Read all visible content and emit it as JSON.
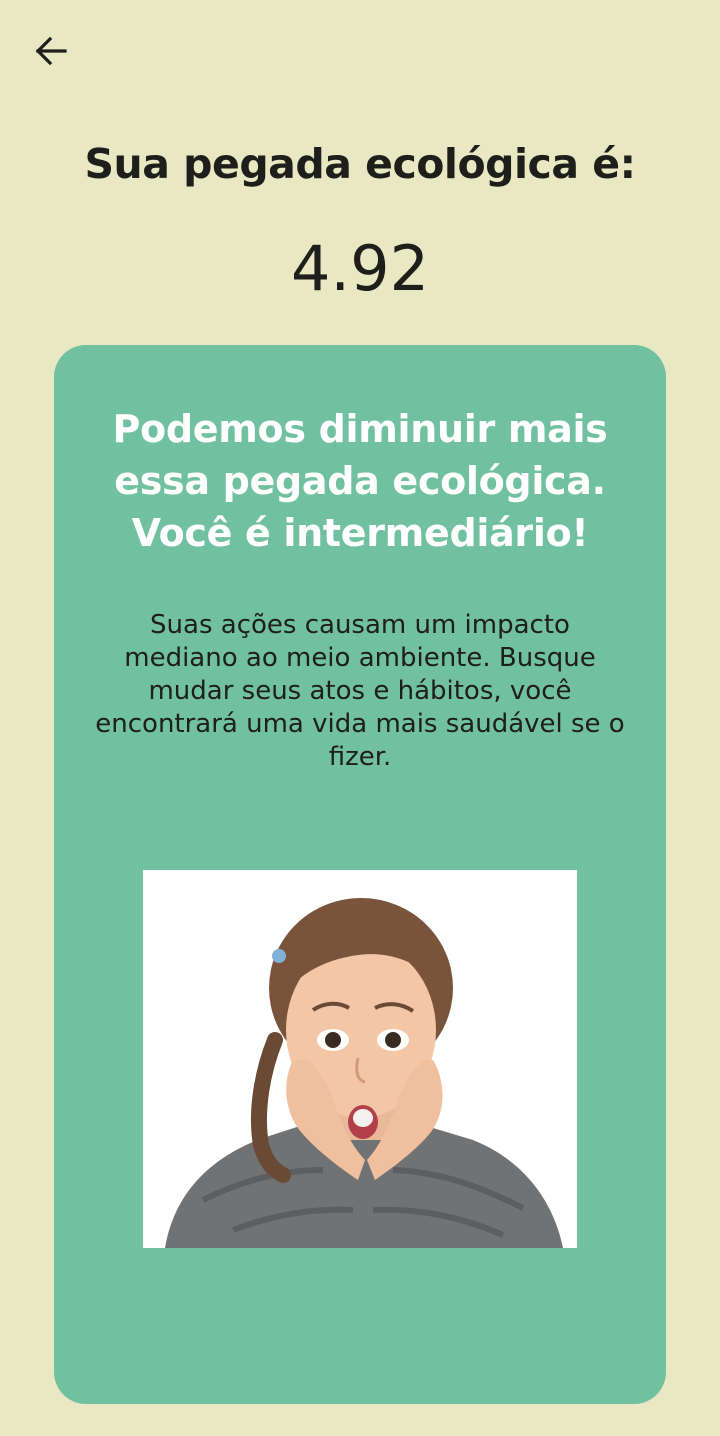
{
  "header": {
    "back_icon": "arrow-left-icon"
  },
  "result": {
    "heading": "Sua pegada ecológica é:",
    "score": "4.92"
  },
  "card": {
    "title": "Podemos diminuir mais essa pegada ecológica. Você é intermediário!",
    "description": "Suas ações causam um impacto mediano ao meio ambiente. Busque mudar seus atos e hábitos, você encontrará uma vida mais saudável se o fizer.",
    "background_color": "#71c1a0",
    "image_icon": "surprised-child-image"
  },
  "colors": {
    "page_background": "#e8e8c2",
    "card_background": "#71c1a0"
  }
}
